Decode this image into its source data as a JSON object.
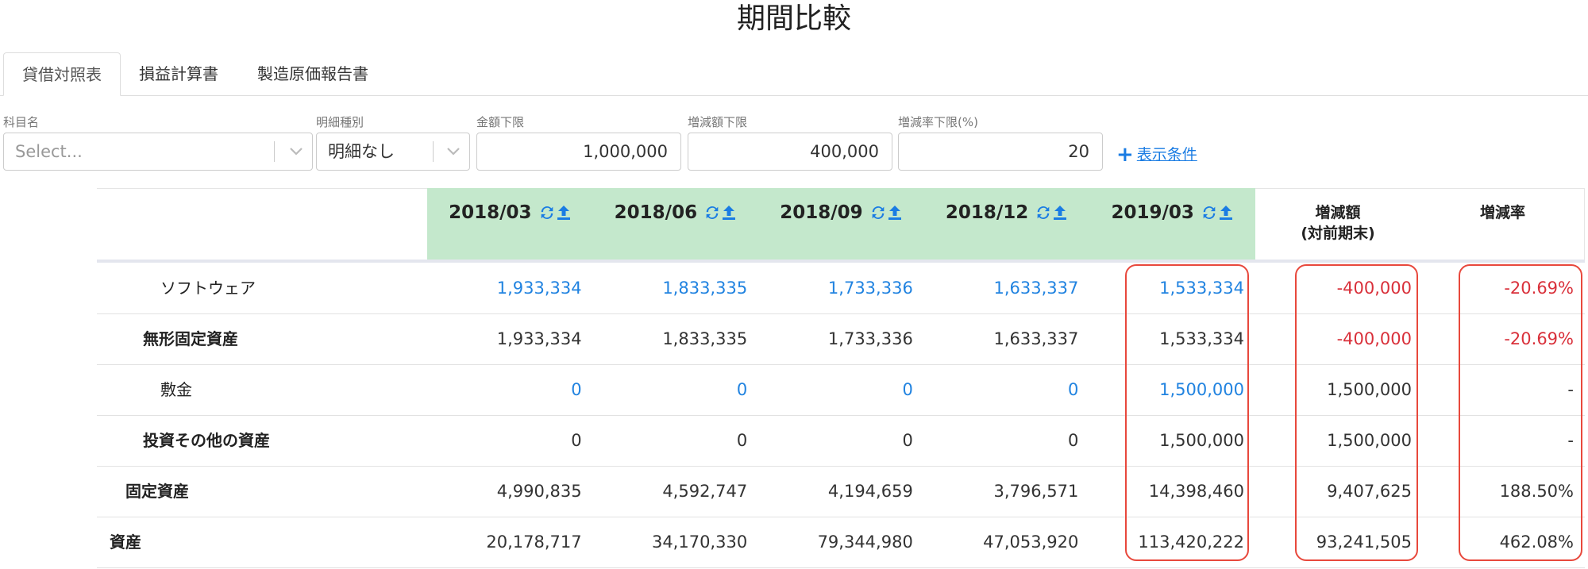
{
  "page_title": "期間比較",
  "tabs": [
    {
      "label": "貸借対照表",
      "active": true
    },
    {
      "label": "損益計算書",
      "active": false
    },
    {
      "label": "製造原価報告書",
      "active": false
    }
  ],
  "filters": {
    "account": {
      "label": "科目名",
      "placeholder": "Select..."
    },
    "detail_type": {
      "label": "明細種別",
      "value": "明細なし"
    },
    "amount_min": {
      "label": "金額下限",
      "value": "1,000,000"
    },
    "change_min": {
      "label": "増減額下限",
      "value": "400,000"
    },
    "rate_min": {
      "label": "増減率下限(%)",
      "value": "20"
    },
    "add_condition": "表示条件"
  },
  "table": {
    "periods": [
      "2018/03",
      "2018/06",
      "2018/09",
      "2018/12",
      "2019/03"
    ],
    "change_header_line1": "増減額",
    "change_header_line2": "(対前期末)",
    "rate_header": "増減率",
    "rows": [
      {
        "label": "ソフトウェア",
        "level": 3,
        "link": true,
        "values": [
          "1,933,334",
          "1,833,335",
          "1,733,336",
          "1,633,337",
          "1,533,334"
        ],
        "change": "-400,000",
        "rate": "-20.69%",
        "negative": true
      },
      {
        "label": "無形固定資産",
        "level": 2,
        "link": false,
        "values": [
          "1,933,334",
          "1,833,335",
          "1,733,336",
          "1,633,337",
          "1,533,334"
        ],
        "change": "-400,000",
        "rate": "-20.69%",
        "negative": true
      },
      {
        "label": "敷金",
        "level": 3,
        "link": true,
        "values": [
          "0",
          "0",
          "0",
          "0",
          "1,500,000"
        ],
        "change": "1,500,000",
        "rate": "-",
        "negative": false
      },
      {
        "label": "投資その他の資産",
        "level": 2,
        "link": false,
        "values": [
          "0",
          "0",
          "0",
          "0",
          "1,500,000"
        ],
        "change": "1,500,000",
        "rate": "-",
        "negative": false
      },
      {
        "label": "固定資産",
        "level": 1,
        "link": false,
        "values": [
          "4,990,835",
          "4,592,747",
          "4,194,659",
          "3,796,571",
          "14,398,460"
        ],
        "change": "9,407,625",
        "rate": "188.50%",
        "negative": false
      },
      {
        "label": "資産",
        "level": 0,
        "link": false,
        "values": [
          "20,178,717",
          "34,170,330",
          "79,344,980",
          "47,053,920",
          "113,420,222"
        ],
        "change": "93,241,505",
        "rate": "462.08%",
        "negative": false
      }
    ]
  },
  "colors": {
    "header_bg": "#c4e8cc",
    "link": "#2183e0",
    "negative": "#d9303a",
    "highlight_border": "#e8483c",
    "accent": "#1a7ce3"
  },
  "icons": {
    "refresh": "refresh-icon",
    "upload": "upload-icon",
    "chevron": "chevron-down-icon",
    "plus": "plus-icon"
  }
}
